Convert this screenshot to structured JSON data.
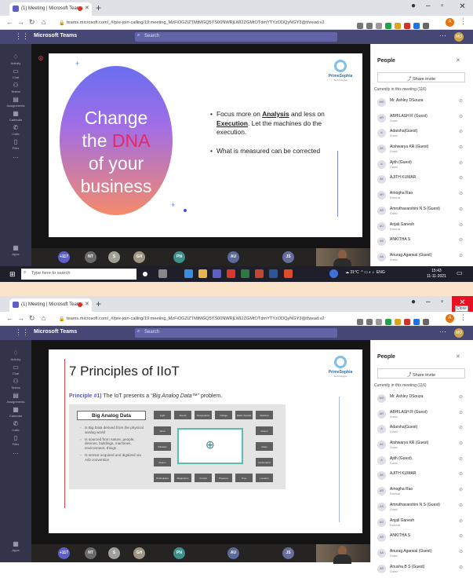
{
  "browser": {
    "tab_title": "(1) Meeting | Microsoft Teams",
    "url": "teams.microsoft.com/_#/pre-join-calling/19:meeting_MzFiOGZiZTMtMGQ5YS00NWRjLWI2ZGMtOTdmYTYzODQyNGY3@thread.v2",
    "close_tooltip": "Close"
  },
  "teams": {
    "brand": "Microsoft Teams",
    "search_placeholder": "Search",
    "user_initials": "MO"
  },
  "rail": [
    "Activity",
    "Chat",
    "Teams",
    "Assignments",
    "Calendar",
    "Calls",
    "Files"
  ],
  "rail_bottom": "Apps",
  "slide1": {
    "headline": [
      "Change",
      "the",
      "DNA",
      "of your",
      "business"
    ],
    "logo_name": "PrimeSophia",
    "logo_sub": "Technologies",
    "bullet1_pre": "Focus more on ",
    "bullet1_b1": "Analysis",
    "bullet1_mid": " and less on ",
    "bullet1_b2": "Execution",
    "bullet1_post": ". Let the machines do the execution.",
    "bullet2": "What is measured can be corrected"
  },
  "slide2": {
    "title": "7 Principles of IIoT",
    "principle_label": "Principle #1)",
    "principle_text": " The IoT presents a ",
    "principle_quote": "“Big Analog Data™”",
    "principle_end": " problem.",
    "big_analog": "Big Analog Data",
    "items": [
      "Is Big Data derived from the physical analog world",
      "Is sourced from nature, people, devices, buildings, machines, environment, things",
      "Is sensor acquired and digitized via A/D conversion"
    ],
    "top_boxes": [
      "Light",
      "Sound",
      "Temperature",
      "Voltage",
      "Radio Signals",
      "Moisture"
    ],
    "left_boxes": [
      "Wind",
      "Vibration",
      "Motion"
    ],
    "right_boxes": [
      "Motion",
      "Video",
      "Acceleration"
    ],
    "bottom_boxes": [
      "Particulates",
      "Magnetism",
      "Current",
      "Pressure",
      "Time",
      "Location"
    ]
  },
  "strip": {
    "count": "+117",
    "avatars": [
      "NT",
      "S",
      "GH",
      "PN",
      "AU",
      "JS"
    ]
  },
  "people": {
    "title": "People",
    "share_invite": "Share invite",
    "currently": "Currently in this meeting (116)",
    "list1": [
      {
        "i": "MO",
        "name": "Mr. Ashley DSouza",
        "sub": ""
      },
      {
        "i": "AR",
        "name": "ABHILASH R (Guest)",
        "sub": "Guest"
      },
      {
        "i": "A",
        "name": "Adarsha(Guest)",
        "sub": "Guest"
      },
      {
        "i": "AK",
        "name": "Aishwarya KR (Guest)",
        "sub": "Guest"
      },
      {
        "i": "A",
        "name": "Ajith (Guest)",
        "sub": "Guest"
      },
      {
        "i": "AK",
        "name": "AJITH KUMAR",
        "sub": ""
      },
      {
        "i": "AR",
        "name": "Amogha Rao",
        "sub": "External"
      },
      {
        "i": "AS",
        "name": "Amruthavarshini N S (Guest)",
        "sub": "Guest"
      },
      {
        "i": "AG",
        "name": "Anjali Ganesh",
        "sub": "External"
      },
      {
        "i": "AS",
        "name": "ANKITHA S",
        "sub": ""
      },
      {
        "i": "AA",
        "name": "Anurag Agarwal (Guest)",
        "sub": "Guest"
      }
    ],
    "list2": [
      {
        "i": "MO",
        "name": "Mr. Ashley DSouza",
        "sub": ""
      },
      {
        "i": "AR",
        "name": "ABHILASH R (Guest)",
        "sub": "Guest"
      },
      {
        "i": "A",
        "name": "Adarsha(Guest)",
        "sub": "Guest"
      },
      {
        "i": "AK",
        "name": "Aishwarya KR (Guest)",
        "sub": "Guest"
      },
      {
        "i": "A",
        "name": "Ajith (Guest)",
        "sub": "Guest"
      },
      {
        "i": "AK",
        "name": "AJITH KUMAR",
        "sub": ""
      },
      {
        "i": "AR",
        "name": "Amogha Rao",
        "sub": "External"
      },
      {
        "i": "AS",
        "name": "Amruthavarshini N S (Guest)",
        "sub": "Guest"
      },
      {
        "i": "AG",
        "name": "Anjali Ganesh",
        "sub": "External"
      },
      {
        "i": "AS",
        "name": "ANKITHA S",
        "sub": ""
      },
      {
        "i": "AA",
        "name": "Anurag Agarwal (Guest)",
        "sub": "Guest"
      },
      {
        "i": "AS",
        "name": "Anusha B S (Guest)",
        "sub": "Guest"
      }
    ]
  },
  "taskbar": {
    "search": "Type here to search",
    "weather": "31°C",
    "lang": "ENG",
    "time": "15:43",
    "date": "11-11-2021"
  }
}
